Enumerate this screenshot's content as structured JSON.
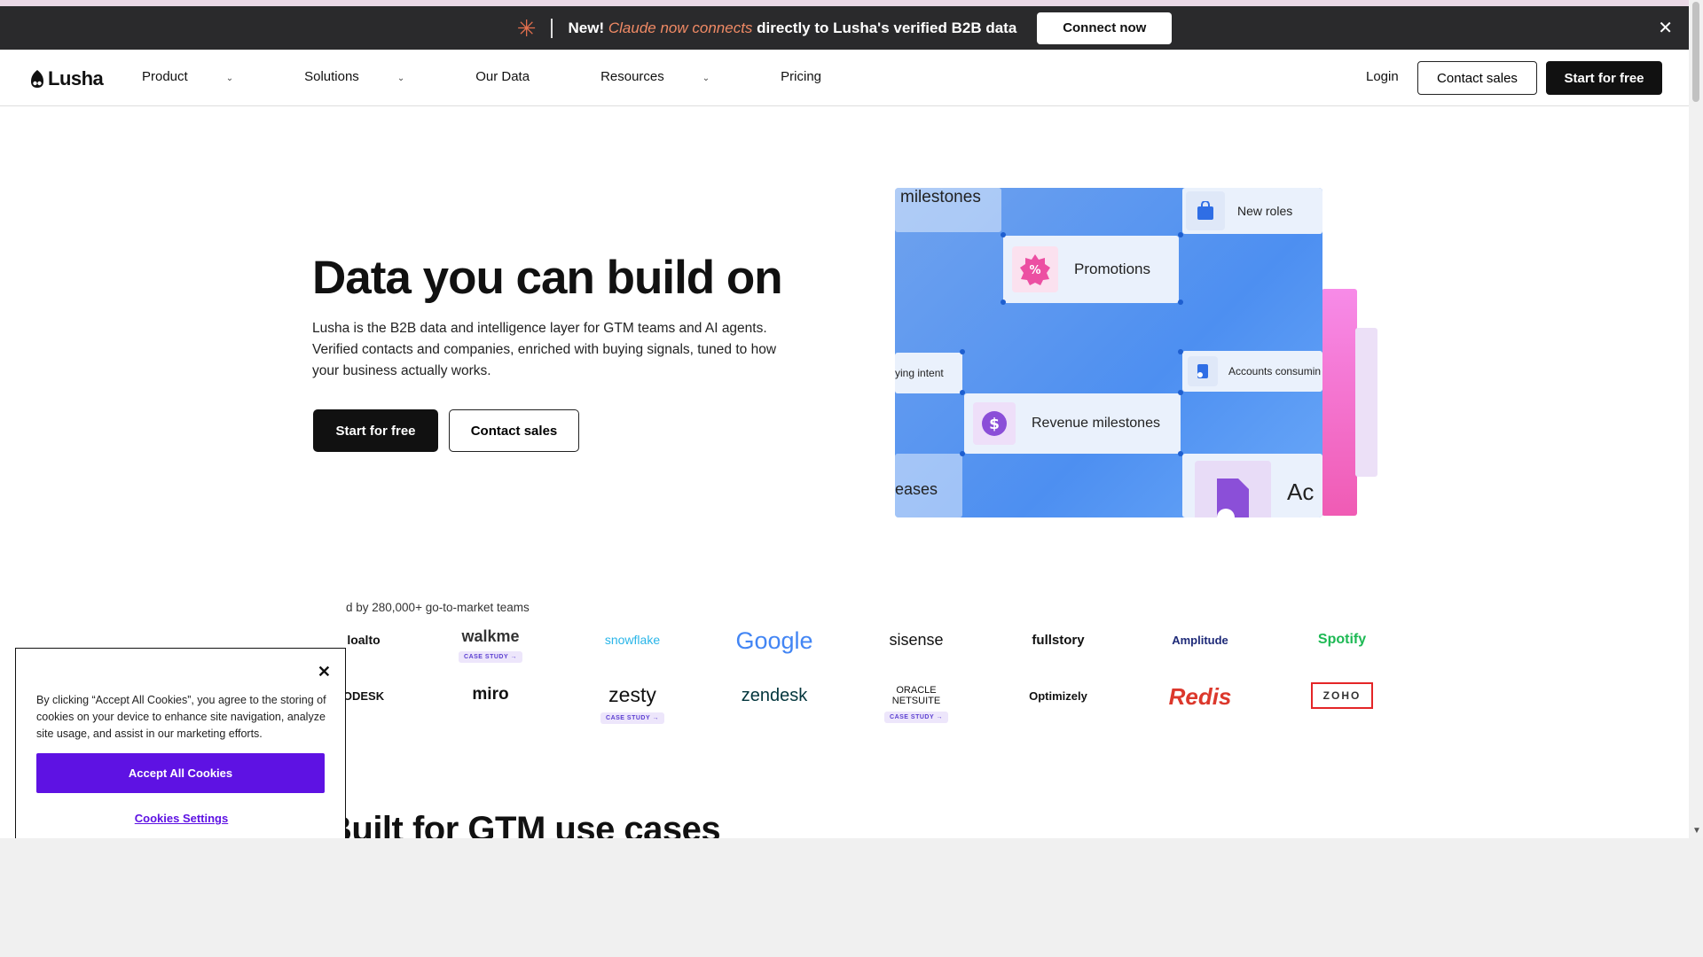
{
  "announcement": {
    "new_label": "New!",
    "highlight": "Claude now connects",
    "rest": " directly to Lusha's verified B2B data",
    "button": "Connect now",
    "close_glyph": "✕",
    "spark_glyph": "✳"
  },
  "nav": {
    "brand": "Lusha",
    "items": [
      {
        "label": "Product",
        "has_dropdown": true
      },
      {
        "label": "Solutions",
        "has_dropdown": true
      },
      {
        "label": "Our Data",
        "has_dropdown": false
      },
      {
        "label": "Resources",
        "has_dropdown": true
      },
      {
        "label": "Pricing",
        "has_dropdown": false
      }
    ],
    "login": "Login",
    "contact": "Contact sales",
    "start": "Start for free"
  },
  "hero": {
    "title": "Data you can build on",
    "subtitle": "Lusha is the B2B data and intelligence layer for GTM teams and AI agents. Verified contacts and companies, enriched with buying signals, tuned to how your business actually works.",
    "start": "Start for free",
    "contact": "Contact sales"
  },
  "visual": {
    "milestones": "milestones",
    "new_roles": "New roles",
    "promotions": "Promotions",
    "buying_intent": "ying intent",
    "accounts": "Accounts consumin",
    "revenue": "Revenue milestones",
    "releases": "eases",
    "ac": "Ac",
    "colors": {
      "promo_icon": "#ec4fa2",
      "revenue_icon": "#8b4fd8",
      "bag_icon": "#2f6ee5"
    }
  },
  "trusted": {
    "caption": "d by 280,000+ go-to-market teams",
    "case_label": "CASE STUDY →",
    "row1": [
      "loalto",
      "walkme",
      "snowflake",
      "Google",
      "sisense",
      "fullstory",
      "Amplitude",
      "Spotify"
    ],
    "row2": [
      "ODESK",
      "miro",
      "zesty",
      "zendesk",
      "ORACLE NETSUITE",
      "Optimizely",
      "Redis",
      "ZOHO"
    ]
  },
  "section2": {
    "title": "Built for GTM use cases"
  },
  "cookie": {
    "text": "By clicking “Accept All Cookies”, you agree to the storing of cookies on your device to enhance site navigation, analyze site usage, and assist in our marketing efforts.",
    "accept": "Accept All Cookies",
    "settings": "Cookies Settings",
    "close_glyph": "✕"
  }
}
